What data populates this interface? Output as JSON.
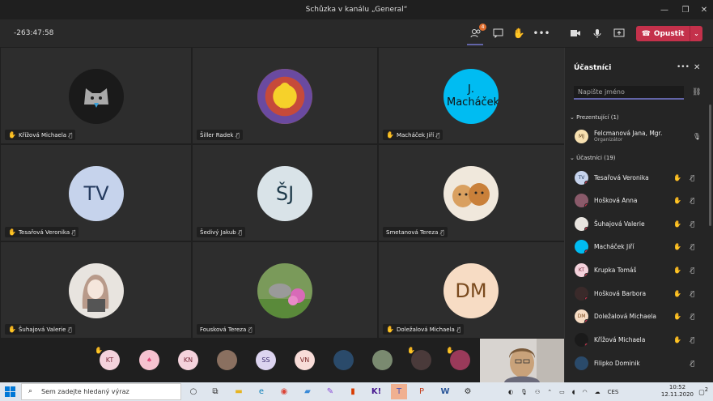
{
  "window": {
    "title": "Schůzka v kanálu „General“"
  },
  "toolbar": {
    "timer": "-263:47:58",
    "participants_badge": "4",
    "leave_label": "Opustit"
  },
  "tiles": [
    {
      "name": "Křížová Michaela",
      "initials": "",
      "color": "#1a1a1a",
      "hand": true
    },
    {
      "name": "Šiller Radek",
      "initials": "",
      "color": "#c64a3a",
      "hand": false
    },
    {
      "name": "Macháček Jiří",
      "initials": "J. Macháček",
      "color": "#00bcf2",
      "hand": true
    },
    {
      "name": "Tesařová Veronika",
      "initials": "TV",
      "color": "#c6d3ec",
      "hand": true
    },
    {
      "name": "Šedivý Jakub",
      "initials": "ŠJ",
      "color": "#d9e3e8",
      "hand": false
    },
    {
      "name": "Smetanová Tereza",
      "initials": "",
      "color": "#c9a070",
      "hand": false
    },
    {
      "name": "Šuhajová Valerie",
      "initials": "",
      "color": "#e8e4df",
      "hand": true
    },
    {
      "name": "Fousková Tereza",
      "initials": "",
      "color": "#8a9a70",
      "hand": false
    },
    {
      "name": "Doležalová Michaela",
      "initials": "DM",
      "color": "#f7dcc4",
      "hand": true
    }
  ],
  "strip": [
    {
      "initials": "KT",
      "color": "#f4d2dc",
      "hand": true
    },
    {
      "initials": "",
      "color": "#f6c2d0",
      "hand": false
    },
    {
      "initials": "KN",
      "color": "#f4d2dc",
      "hand": false
    },
    {
      "initials": "",
      "color": "#8a7060",
      "hand": false
    },
    {
      "initials": "SS",
      "color": "#dcd4f0",
      "hand": false
    },
    {
      "initials": "VN",
      "color": "#f8dcd8",
      "hand": false
    },
    {
      "initials": "",
      "color": "#2a4a6a",
      "hand": false
    },
    {
      "initials": "",
      "color": "#7a8a70",
      "hand": false
    },
    {
      "initials": "",
      "color": "#4a3a3a",
      "hand": true
    },
    {
      "initials": "",
      "color": "#9a3a5a",
      "hand": true
    }
  ],
  "panel": {
    "title": "Účastníci",
    "search_placeholder": "Napište jméno",
    "presenters_label": "Prezentující (1)",
    "attendees_label": "Účastníci (19)",
    "presenter": {
      "name": "Felcmanová Jana, Mgr.",
      "role": "Organizátor",
      "initials": "MJ",
      "color": "#f7e0b0"
    },
    "attendees": [
      {
        "name": "Tesařová Veronika",
        "initials": "TV",
        "color": "#c6d3ec",
        "hand": true
      },
      {
        "name": "Hošková Anna",
        "initials": "",
        "color": "#8a5a6a",
        "hand": true
      },
      {
        "name": "Šuhajová Valerie",
        "initials": "",
        "color": "#e8e4df",
        "hand": true
      },
      {
        "name": "Macháček Jiří",
        "initials": "",
        "color": "#00bcf2",
        "hand": true
      },
      {
        "name": "Krupka Tomáš",
        "initials": "KT",
        "color": "#f4d2dc",
        "hand": true
      },
      {
        "name": "Hošková Barbora",
        "initials": "",
        "color": "#3a2a2a",
        "hand": true
      },
      {
        "name": "Doležalová Michaela",
        "initials": "DM",
        "color": "#f7dcc4",
        "hand": true
      },
      {
        "name": "Křížová Michaela",
        "initials": "",
        "color": "#1a1a1a",
        "hand": true
      },
      {
        "name": "Filipko Dominik",
        "initials": "",
        "color": "#2a4a6a",
        "hand": false
      }
    ]
  },
  "taskbar": {
    "search_placeholder": "Sem zadejte hledaný výraz",
    "lang": "CES",
    "time": "10:52",
    "date": "12.11.2020",
    "notif_count": "2"
  }
}
